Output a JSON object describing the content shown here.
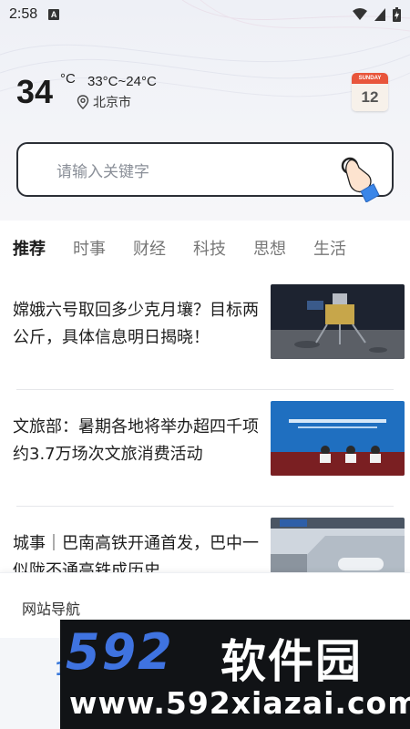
{
  "status_bar": {
    "time": "2:58",
    "notification_letter": "A",
    "icons": [
      "wifi-icon",
      "signal-icon",
      "battery-icon"
    ]
  },
  "weather": {
    "temperature": "34",
    "unit": "°C",
    "range": "33°C~24°C",
    "city": "北京市"
  },
  "calendar": {
    "weekday": "SUNDAY",
    "day": "12"
  },
  "search": {
    "placeholder": "请输入关键字"
  },
  "tabs": [
    {
      "label": "推荐",
      "active": true
    },
    {
      "label": "时事",
      "active": false
    },
    {
      "label": "财经",
      "active": false
    },
    {
      "label": "科技",
      "active": false
    },
    {
      "label": "思想",
      "active": false
    },
    {
      "label": "生活",
      "active": false
    }
  ],
  "news": [
    {
      "title": "嫦娥六号取回多少克月壤？目标两公斤，具体信息明日揭晓！",
      "thumb": "lunar-lander-image"
    },
    {
      "title": "文旅部：暑期各地将举办超四千项约3.7万场次文旅消费活动",
      "thumb": "press-conference-image"
    },
    {
      "title": "城事｜巴南高铁开通首发，巴中一似陇不通高铁成历史",
      "thumb": "railway-station-image"
    }
  ],
  "site_nav": {
    "title": "网站导航"
  },
  "watermark": {
    "number": "592",
    "name": "软件园",
    "url": "www.592xiazai.com"
  },
  "colors": {
    "accent_blue": "#3f73e0",
    "calendar_red": "#e8553b",
    "search_border": "#2b2f36"
  }
}
